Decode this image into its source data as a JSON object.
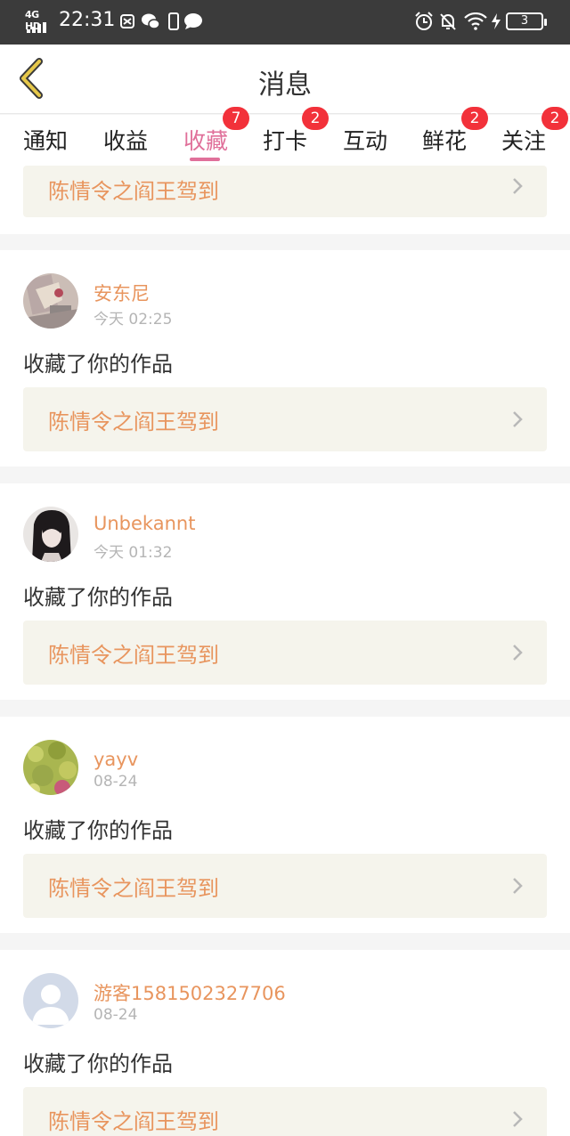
{
  "status_bar": {
    "network": "4G HD",
    "time": "22:31",
    "battery": "3"
  },
  "navbar": {
    "title": "消息"
  },
  "tabs": [
    {
      "label": "通知"
    },
    {
      "label": "收益"
    },
    {
      "label": "收藏",
      "badge": "7",
      "active": true
    },
    {
      "label": "打卡",
      "badge": "2"
    },
    {
      "label": "互动"
    },
    {
      "label": "鲜花",
      "badge": "2"
    },
    {
      "label": "关注",
      "badge": "2"
    }
  ],
  "colors": {
    "accent": "#e0709a",
    "name_orange": "#e8955e",
    "badge_red": "#f2313a",
    "work_box_bg": "#f5f4ec"
  },
  "top_partial_card": {
    "work_title": "陈情令之阎王驾到"
  },
  "messages": [
    {
      "username": "安东尼",
      "time": "今天 02:25",
      "action": "收藏了你的作品",
      "work_title": "陈情令之阎王驾到",
      "avatar_icon": "photo-avatar"
    },
    {
      "username": "Unbekannt",
      "time": "今天 01:32",
      "action": "收藏了你的作品",
      "work_title": "陈情令之阎王驾到",
      "avatar_icon": "photo-avatar"
    },
    {
      "username": "yayv",
      "time": "08-24",
      "action": "收藏了你的作品",
      "work_title": "陈情令之阎王驾到",
      "avatar_icon": "photo-avatar"
    },
    {
      "username": "游客1581502327706",
      "time": "08-24",
      "action": "收藏了你的作品",
      "work_title": "陈情令之阎王驾到",
      "avatar_icon": "default-user-avatar"
    }
  ]
}
